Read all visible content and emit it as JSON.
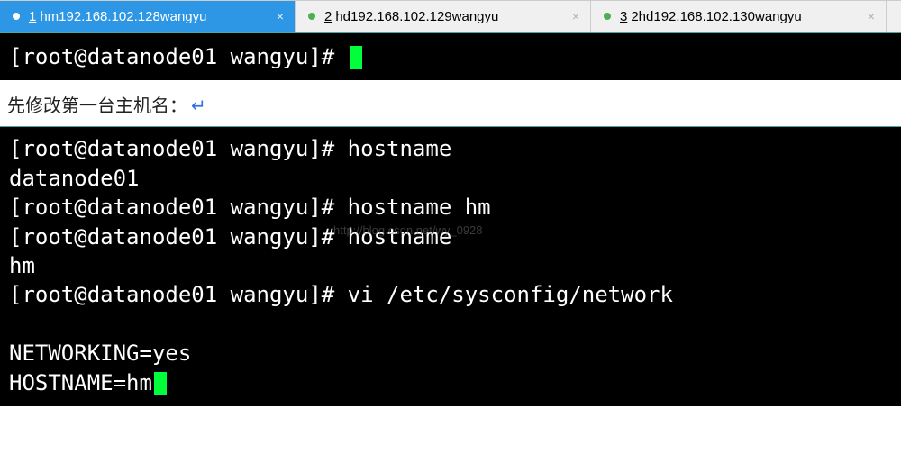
{
  "tabs": [
    {
      "num": "1",
      "label": "hm192.168.102.128wangyu",
      "active": true
    },
    {
      "num": "2",
      "label": "hd192.168.102.129wangyu",
      "active": false
    },
    {
      "num": "3",
      "label": "2hd192.168.102.130wangyu",
      "active": false
    }
  ],
  "terminal1": {
    "prompt": "[root@datanode01 wangyu]# "
  },
  "caption": "先修改第一台主机名：",
  "terminal2": {
    "lines": [
      "[root@datanode01 wangyu]# hostname",
      "datanode01",
      "[root@datanode01 wangyu]# hostname hm",
      "[root@datanode01 wangyu]# hostname",
      "hm",
      "[root@datanode01 wangyu]# vi /etc/sysconfig/network",
      "",
      "NETWORKING=yes",
      "HOSTNAME=hm"
    ]
  },
  "watermark": "http://blog.csdn.net/wy_0928"
}
